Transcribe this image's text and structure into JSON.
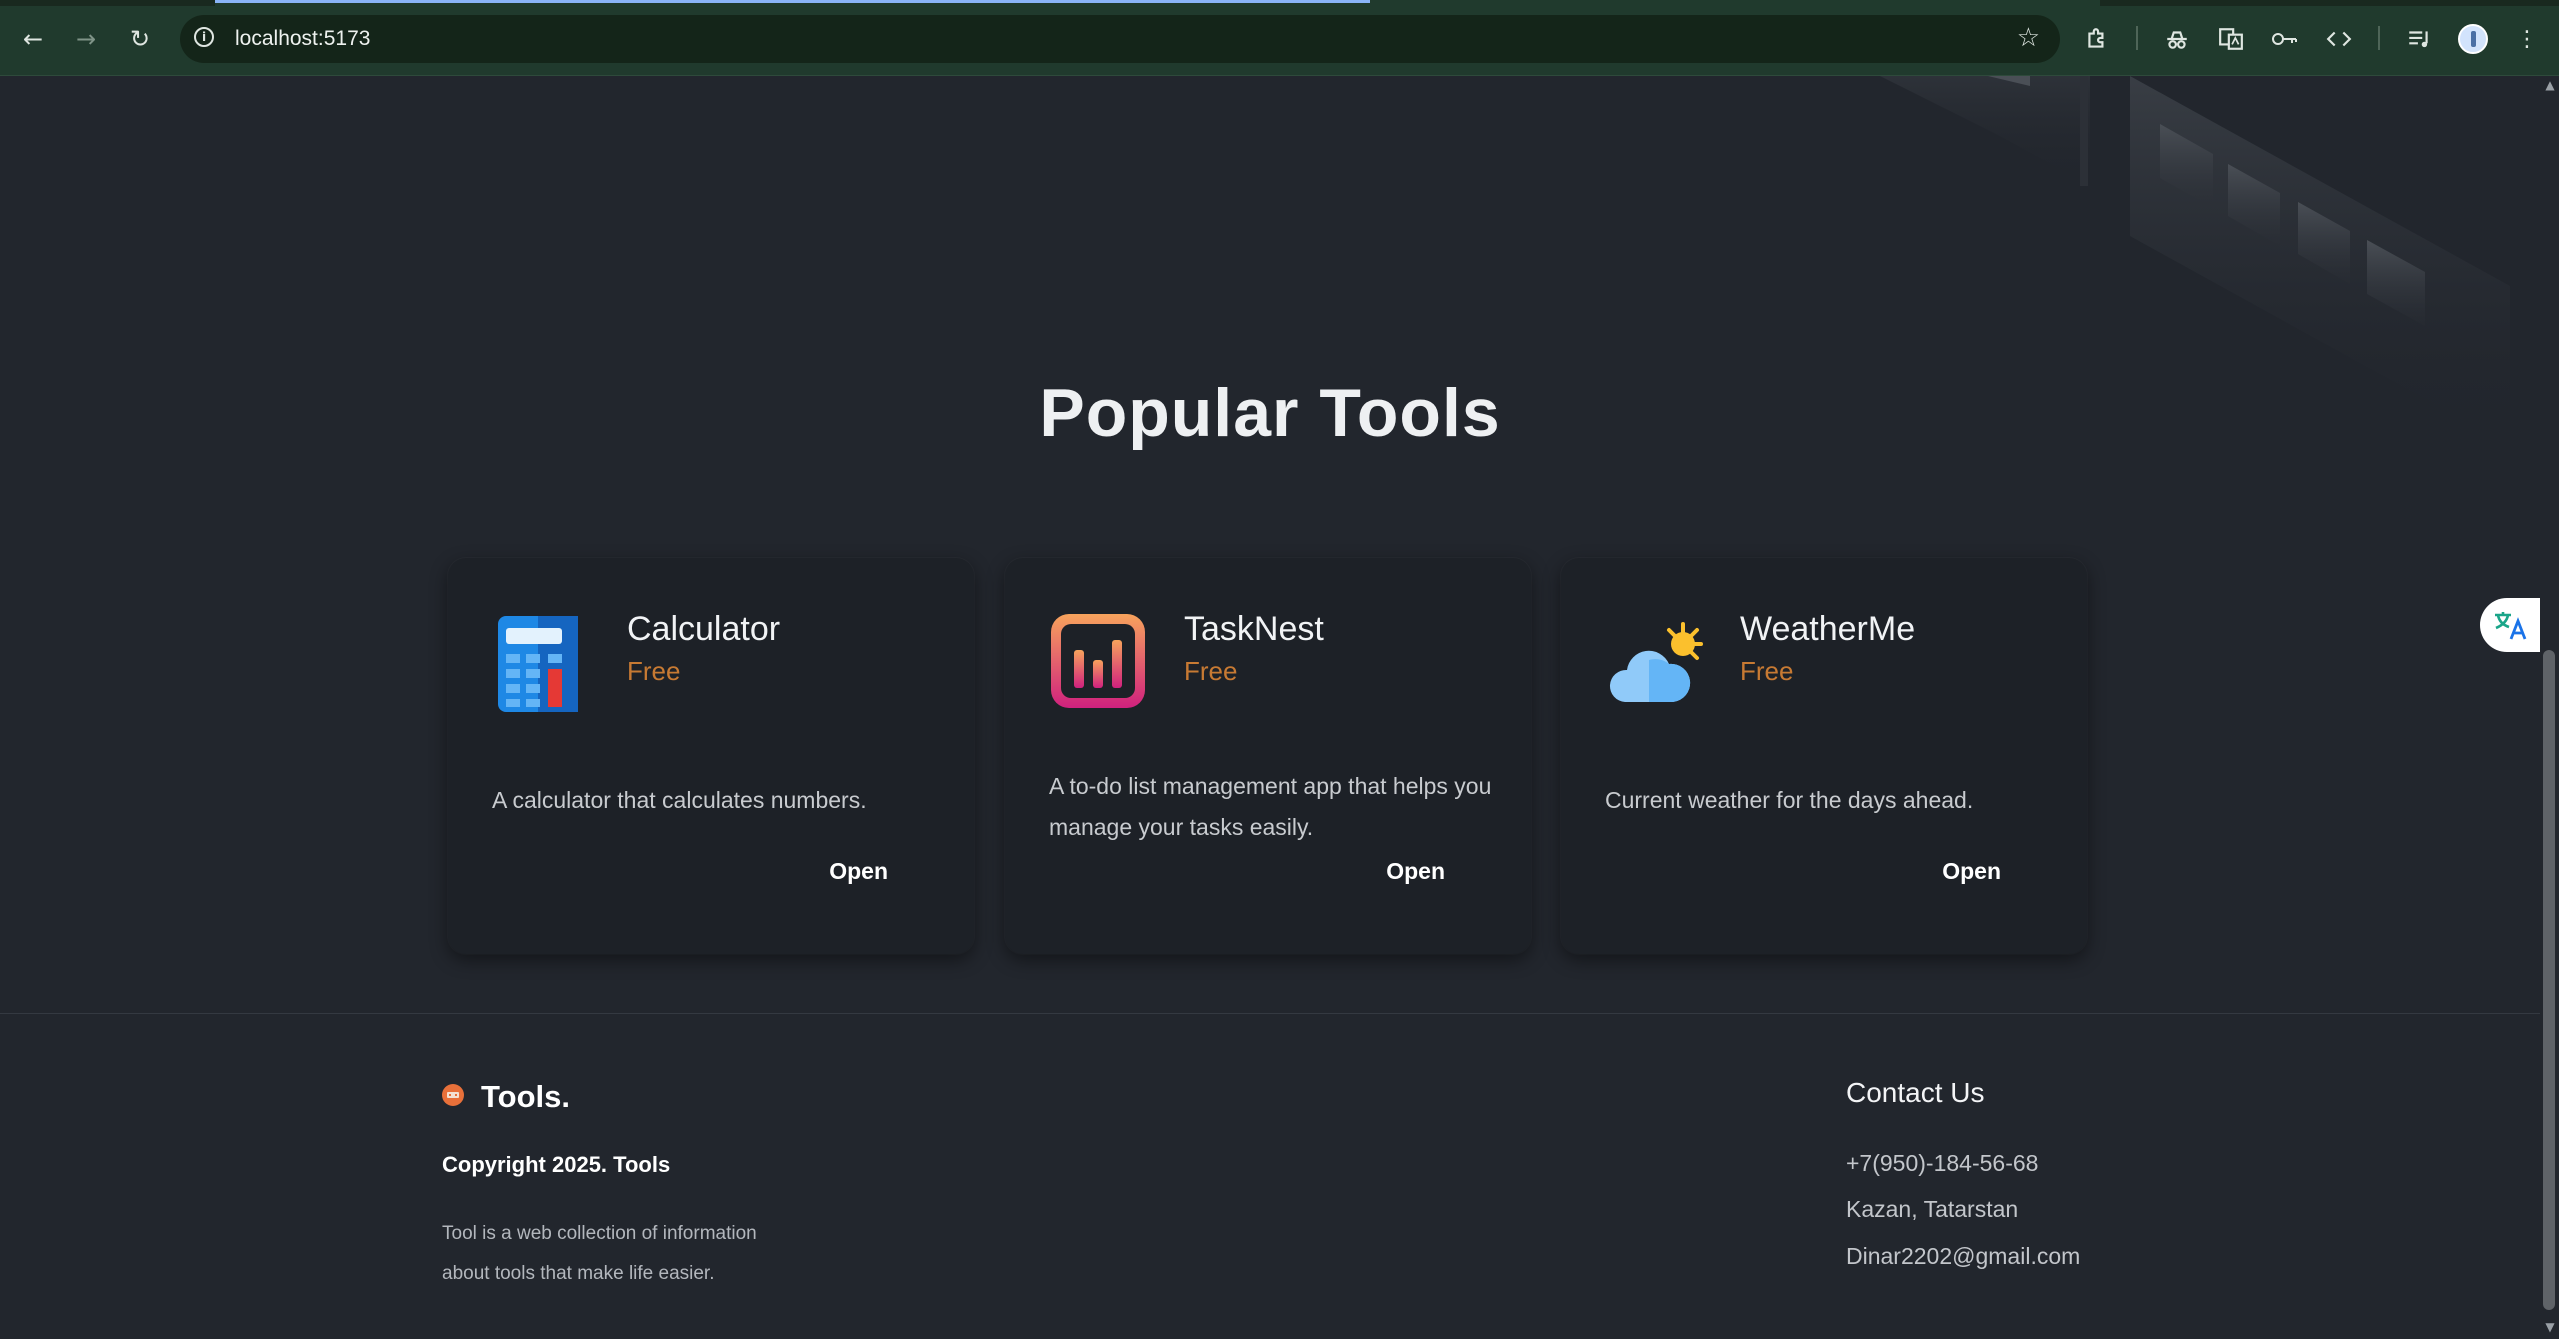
{
  "browser": {
    "url": "localhost:5173",
    "back_icon": "←",
    "forward_icon": "→",
    "reload_icon": "↻",
    "star_icon": "☆",
    "menu_icon": "⋮"
  },
  "page": {
    "section_title": "Popular Tools",
    "tools": [
      {
        "name": "Calculator",
        "price": "Free",
        "description": "A calculator that calculates numbers.",
        "action": "Open",
        "icon": "calculator-icon"
      },
      {
        "name": "TaskNest",
        "price": "Free",
        "description": "A to-do list management app that helps you manage your tasks easily.",
        "action": "Open",
        "icon": "tasknest-chart-icon"
      },
      {
        "name": "WeatherMe",
        "price": "Free",
        "description": "Current weather for the days ahead.",
        "action": "Open",
        "icon": "weather-cloud-sun-icon"
      }
    ]
  },
  "footer": {
    "logo": "Tools.",
    "copyright": "Copyright 2025. Tools",
    "about": "Tool is a web collection of information about tools that make life easier.",
    "contact_title": "Contact Us",
    "phone": "+7(950)-184-56-68",
    "location": "Kazan, Tatarstan",
    "email": "Dinar2202@gmail.com"
  },
  "colors": {
    "background": "#22262d",
    "card": "#1d2127",
    "price_accent": "#c77a33",
    "chrome": "#203a2d"
  }
}
